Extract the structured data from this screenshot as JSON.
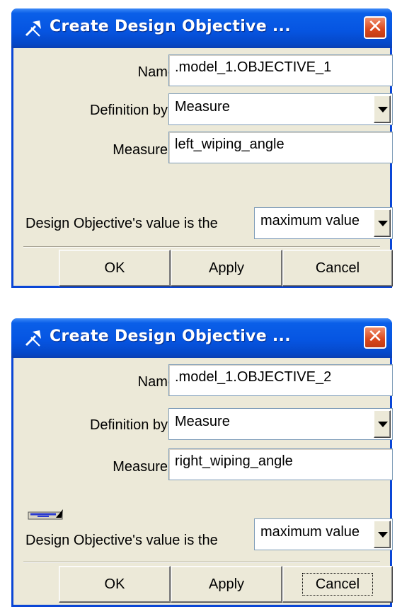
{
  "dialogs": [
    {
      "title": "Create Design Objective ...",
      "close_label": "✕",
      "name_label": "Name",
      "name_value": ".model_1.OBJECTIVE_1",
      "definition_label": "Definition by",
      "definition_value": "Measure",
      "measure_label": "Measure",
      "measure_value": "left_wiping_angle",
      "value_is_label": "Design Objective's value is the",
      "value_is_value": "maximum value",
      "ok_label": "OK",
      "apply_label": "Apply",
      "cancel_label": "Cancel"
    },
    {
      "title": "Create Design Objective ...",
      "close_label": "✕",
      "name_label": "Name",
      "name_value": ".model_1.OBJECTIVE_2",
      "definition_label": "Definition by",
      "definition_value": "Measure",
      "measure_label": "Measure",
      "measure_value": "right_wiping_angle",
      "value_is_label": "Design Objective's value is the",
      "value_is_value": "maximum value",
      "ok_label": "OK",
      "apply_label": "Apply",
      "cancel_label": "Cancel"
    }
  ],
  "colors": {
    "titlebar": "#0655e2",
    "window_bg": "#ece9d8",
    "close_button": "#d9471c"
  },
  "icons": {
    "title_icon": "pin-tool-icon",
    "close_icon": "close-icon",
    "dropdown_icon": "chevron-down-icon",
    "tool_icon": "toolbar-tool-icon"
  }
}
